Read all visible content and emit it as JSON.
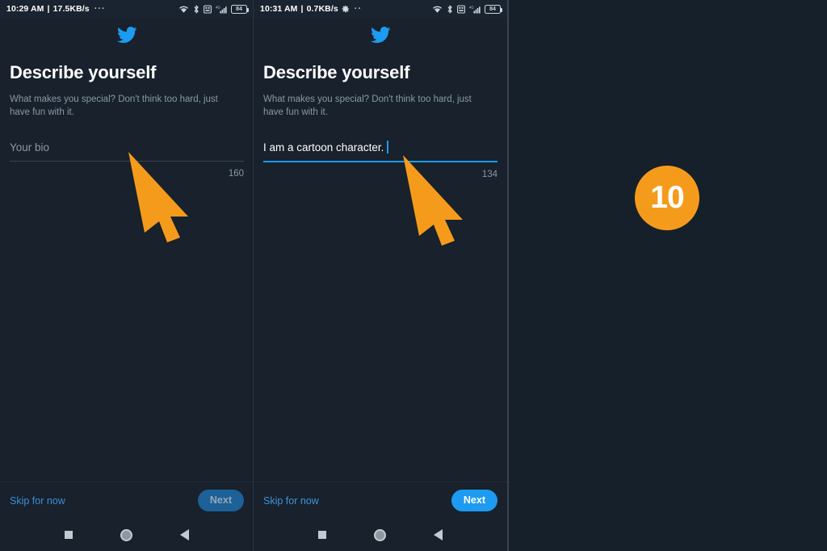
{
  "app": {
    "name": "Twitter",
    "accent_color": "#1d9bf0",
    "background_color": "#18212c",
    "page_background": "#15202b",
    "logo_icon": "twitter-bird-icon"
  },
  "step_badge": {
    "number": "10",
    "color": "#f59b1b"
  },
  "panels": [
    {
      "id": "before",
      "status_bar": {
        "time": "10:29 AM",
        "separator": "|",
        "network_speed": "17.5KB/s",
        "overflow": "···",
        "has_gear": false,
        "icons": [
          "wifi-icon",
          "bluetooth-icon",
          "vpn-icon",
          "signal-icon",
          "battery-icon"
        ],
        "battery_level": "84"
      },
      "title": "Describe yourself",
      "subtitle": "What makes you special? Don't think too hard, just have fun with it.",
      "bio_field": {
        "placeholder": "Your bio",
        "value": "",
        "is_filled": false,
        "is_focused": false,
        "char_counter": "160"
      },
      "bottom_bar": {
        "skip_label": "Skip for now",
        "next_label": "Next",
        "next_enabled": false
      },
      "nav_bar": {
        "recents": "square-recents-icon",
        "home": "circle-home-icon",
        "back": "triangle-back-icon"
      }
    },
    {
      "id": "after",
      "status_bar": {
        "time": "10:31 AM",
        "separator": "|",
        "network_speed": "0.7KB/s",
        "overflow": "··",
        "has_gear": true,
        "icons": [
          "wifi-icon",
          "bluetooth-icon",
          "vpn-icon",
          "signal-icon",
          "battery-icon"
        ],
        "battery_level": "84"
      },
      "title": "Describe yourself",
      "subtitle": "What makes you special? Don't think too hard, just have fun with it.",
      "bio_field": {
        "placeholder": "Your bio",
        "value": "I am a cartoon character.",
        "is_filled": true,
        "is_focused": true,
        "char_counter": "134"
      },
      "bottom_bar": {
        "skip_label": "Skip for now",
        "next_label": "Next",
        "next_enabled": true
      },
      "nav_bar": {
        "recents": "square-recents-icon",
        "home": "circle-home-icon",
        "back": "triangle-back-icon"
      }
    }
  ],
  "cursors": [
    {
      "id": "cursor-left",
      "color": "#f59b1b",
      "points_at": "bio-input-field"
    },
    {
      "id": "cursor-right",
      "color": "#f59b1b",
      "points_at": "bio-input-field"
    }
  ]
}
